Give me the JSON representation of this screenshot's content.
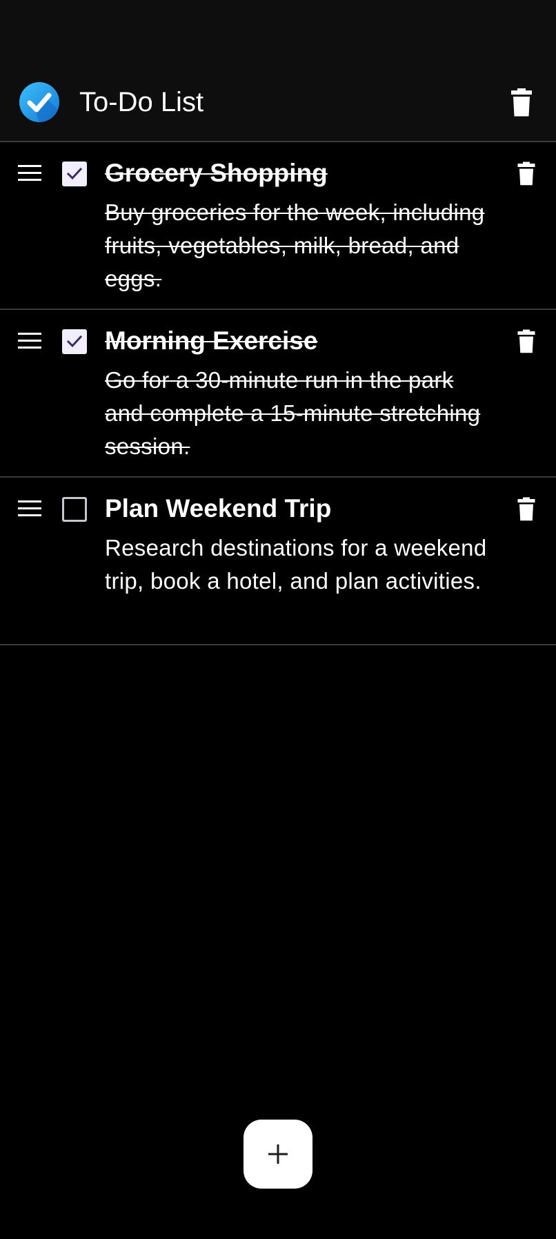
{
  "app_bar": {
    "title": "To-Do List",
    "logo_icon": "check-circle-icon",
    "delete_all_icon": "trash-icon"
  },
  "tasks": [
    {
      "title": "Grocery Shopping",
      "description": "Buy groceries for the week, including fruits, vegetables, milk, bread, and eggs.",
      "completed": true
    },
    {
      "title": "Morning Exercise",
      "description": "Go for a 30-minute run in the park and complete a 15-minute stretching session.",
      "completed": true
    },
    {
      "title": "Plan Weekend Trip",
      "description": "Research destinations for a weekend trip, book a hotel, and plan activities.",
      "completed": false
    }
  ],
  "fab": {
    "icon": "plus-icon"
  },
  "colors": {
    "background": "#000000",
    "app_bar": "#0e0e0f",
    "divider": "#3a3a3c",
    "logo_blue": "#1e9bf0",
    "checkmark": "#3a2a6e",
    "checkbox_fill": "#f3eefc",
    "text": "#ffffff"
  }
}
